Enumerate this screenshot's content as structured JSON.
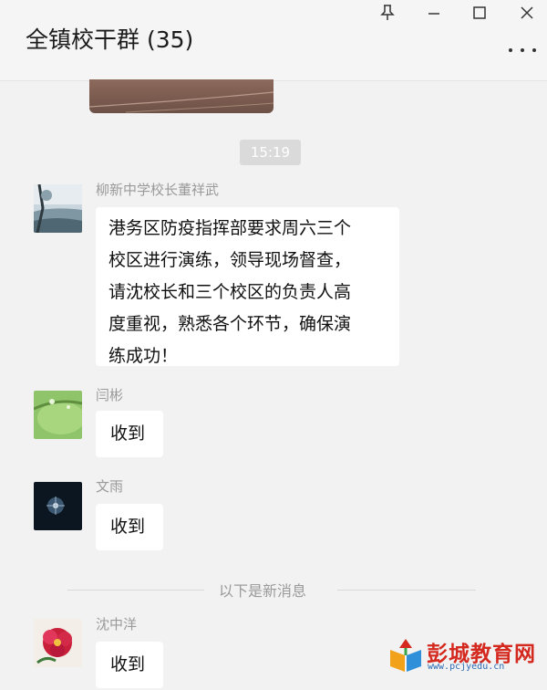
{
  "window": {
    "title": "全镇校干群 (35)",
    "controls": [
      "pin-icon",
      "minimize-icon",
      "maximize-icon",
      "close-icon"
    ],
    "more_icon": "more-icon"
  },
  "chat": {
    "timestamp": "15:19",
    "messages": [
      {
        "sender": "柳新中学校长董祥武",
        "lines": [
          "港务区防疫指挥部要求周六三个",
          "校区进行演练，领导现场督查，",
          "请沈校长和三个校区的负责人高",
          "度重视，熟悉各个环节，确保演",
          "练成功！"
        ]
      },
      {
        "sender": "闫彬",
        "text": "收到"
      },
      {
        "sender": "文雨",
        "text": "收到"
      },
      {
        "sender": "沈中洋",
        "text": "收到"
      }
    ],
    "new_messages_divider": "以下是新消息"
  },
  "watermark": {
    "name": "彭城教育网",
    "url": "www.pcjyedu.cn"
  },
  "colors": {
    "background": "#f2f2f2",
    "bubble": "#ffffff",
    "sender_text": "#9a9a9a",
    "watermark_red": "#d4291f"
  }
}
